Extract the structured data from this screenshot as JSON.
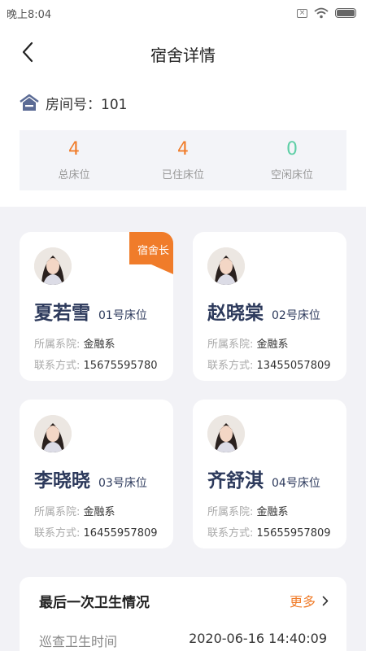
{
  "status_bar": {
    "time": "晚上8:04"
  },
  "header": {
    "title": "宿舍详情"
  },
  "room": {
    "label": "房间号：101"
  },
  "stats": [
    {
      "value": "4",
      "label": "总床位",
      "color": "#f07c2a"
    },
    {
      "value": "4",
      "label": "已住床位",
      "color": "#f07c2a"
    },
    {
      "value": "0",
      "label": "空闲床位",
      "color": "#5ecfa6"
    }
  ],
  "residents": [
    {
      "name": "夏若雪",
      "bed": "01号床位",
      "college_label": "所属系院:",
      "college": "金融系",
      "contact_label": "联系方式:",
      "phone": "15675595780",
      "badge": "宿舍长"
    },
    {
      "name": "赵晓棠",
      "bed": "02号床位",
      "college_label": "所属系院:",
      "college": "金融系",
      "contact_label": "联系方式:",
      "phone": "13455057809"
    },
    {
      "name": "李晓晓",
      "bed": "03号床位",
      "college_label": "所属系院:",
      "college": "金融系",
      "contact_label": "联系方式:",
      "phone": "16455957809"
    },
    {
      "name": "齐舒淇",
      "bed": "04号床位",
      "college_label": "所属系院:",
      "college": "金融系",
      "contact_label": "联系方式:",
      "phone": "15655957809"
    }
  ],
  "hygiene": {
    "title": "最后一次卫生情况",
    "more": "更多",
    "inspect_label": "巡查卫生时间",
    "inspect_time": "2020-06-16 14:40:09"
  },
  "colors": {
    "accent": "#f07c2a",
    "name": "#2d3a5c",
    "vacant": "#5ecfa6",
    "badge": "#f07c2a",
    "room_icon": "#5b6b95"
  }
}
